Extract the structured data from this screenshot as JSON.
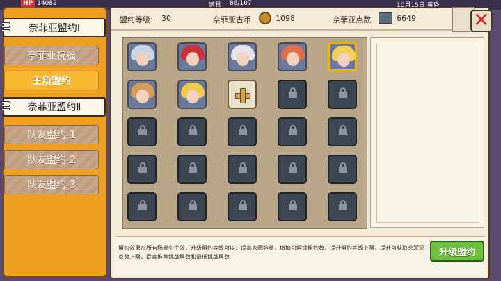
{
  "hud": {
    "hp_label": "HP",
    "hp_value": "14082",
    "item_label": "道具",
    "item_value": "86/107",
    "date": "10月15日 黄昏"
  },
  "sidebar": {
    "items": [
      {
        "label": "奈菲亚盟约Ⅰ",
        "style": "tab"
      },
      {
        "label": "奈菲亚祝福",
        "style": "stripe"
      },
      {
        "label": "主角盟约",
        "style": "active"
      },
      {
        "label": "奈菲亚盟约Ⅱ",
        "style": "tab"
      },
      {
        "label": "队友盟约-1",
        "style": "stripe"
      },
      {
        "label": "队友盟约-2",
        "style": "stripe"
      },
      {
        "label": "队友盟约-3",
        "style": "stripe"
      }
    ]
  },
  "header": {
    "level_label": "盟约等级:",
    "level_value": "30",
    "coin_label": "奈菲亚古币",
    "coin_value": "1098",
    "points_label": "奈菲亚点数",
    "points_value": "6649"
  },
  "grid": {
    "slots": [
      {
        "state": "portrait",
        "hair": "#c9d4e6"
      },
      {
        "state": "portrait",
        "hair": "#c8323a"
      },
      {
        "state": "portrait",
        "hair": "#e4e4ea"
      },
      {
        "state": "portrait",
        "hair": "#e0704a"
      },
      {
        "state": "selected",
        "hair": "#f2cf5a"
      },
      {
        "state": "portrait",
        "hair": "#d99a5a"
      },
      {
        "state": "portrait",
        "hair": "#f0c84a"
      },
      {
        "state": "add"
      },
      {
        "state": "locked"
      },
      {
        "state": "locked"
      },
      {
        "state": "locked"
      },
      {
        "state": "locked"
      },
      {
        "state": "locked"
      },
      {
        "state": "locked"
      },
      {
        "state": "locked"
      },
      {
        "state": "locked"
      },
      {
        "state": "locked"
      },
      {
        "state": "locked"
      },
      {
        "state": "locked"
      },
      {
        "state": "locked"
      },
      {
        "state": "locked"
      },
      {
        "state": "locked"
      },
      {
        "state": "locked"
      },
      {
        "state": "locked"
      },
      {
        "state": "locked"
      }
    ]
  },
  "footer": {
    "description": "盟约效果在所有场景中生效，升级盟约等级可以：提高家园容量，增加可解锁盟约数，提升盟约等级上限，提升可获取奈菲亚点数上限，提高推荐挑战层数和最低挑战层数",
    "upgrade_label": "升级盟约"
  },
  "colors": {
    "accent": "#f0a020",
    "upgrade": "#6cc23a",
    "close": "#dd2222"
  }
}
